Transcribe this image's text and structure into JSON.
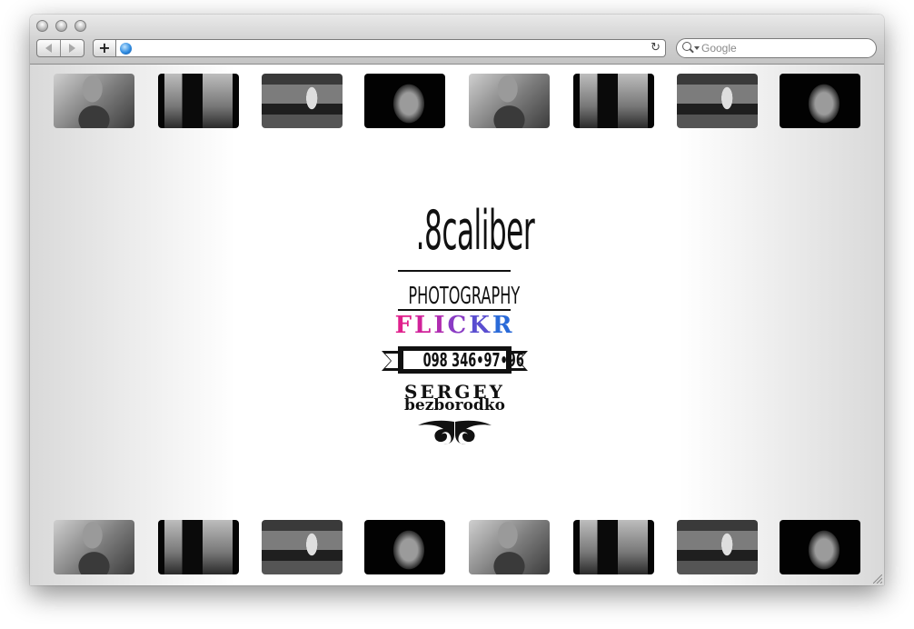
{
  "browser": {
    "url": "",
    "search_placeholder": "Google",
    "add_label": "+",
    "reload_glyph": "↻"
  },
  "site": {
    "brand_title": ".8caliber",
    "brand_subtitle": "PHOTOGRAPHY",
    "flickr_letters": [
      {
        "char": "F",
        "color": "#e0208c"
      },
      {
        "char": "L",
        "color": "#d0229a"
      },
      {
        "char": "I",
        "color": "#b02cb0"
      },
      {
        "char": "C",
        "color": "#8a3cc4"
      },
      {
        "char": "K",
        "color": "#5a4ed0"
      },
      {
        "char": "R",
        "color": "#2a6ad8"
      }
    ],
    "phone": "098 346•97•96",
    "first_name": "SERGEY",
    "last_name": "bezborodko"
  },
  "thumbnails_top": [
    "p1",
    "p2",
    "p3",
    "p4",
    "p1",
    "p2",
    "p3",
    "p4"
  ],
  "thumbnails_bottom": [
    "p1",
    "p2",
    "p3",
    "p4",
    "p1",
    "p2",
    "p3",
    "p4"
  ]
}
